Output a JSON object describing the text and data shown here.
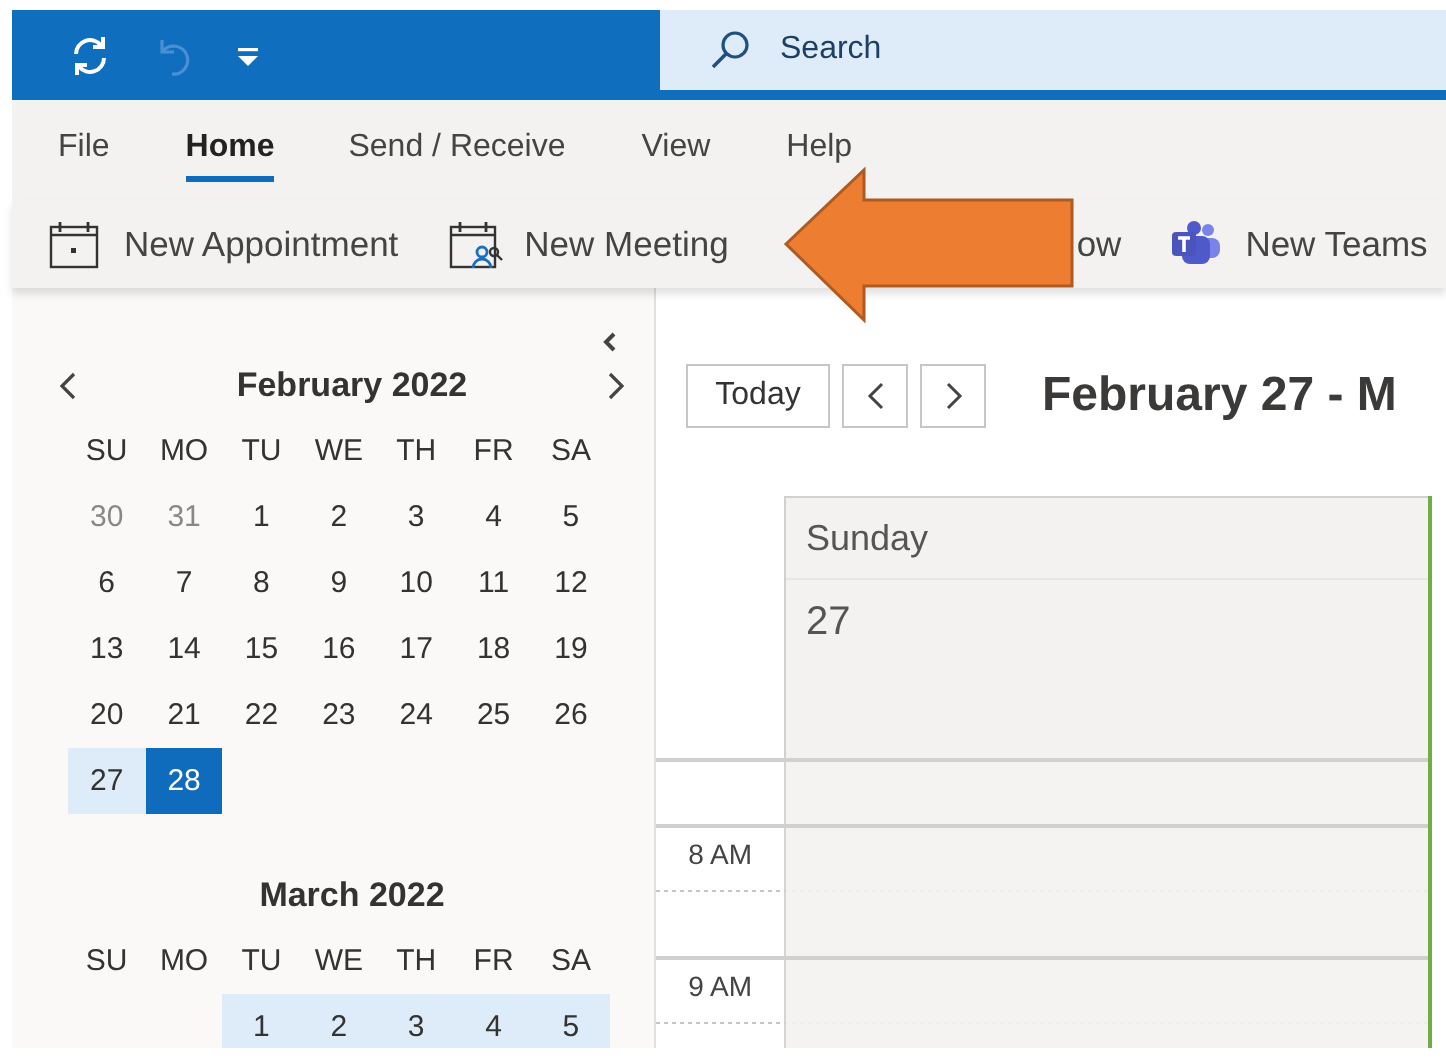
{
  "title_bar": {
    "undo": {
      "disabled": true
    },
    "search": {
      "placeholder": "Search"
    }
  },
  "menu_tabs": [
    {
      "label": "File",
      "selected": false
    },
    {
      "label": "Home",
      "selected": true
    },
    {
      "label": "Send / Receive",
      "selected": false
    },
    {
      "label": "View",
      "selected": false
    },
    {
      "label": "Help",
      "selected": false
    }
  ],
  "ribbon_buttons": [
    {
      "label": "New Appointment",
      "kind": "appointment"
    },
    {
      "label": "New Meeting",
      "kind": "meeting"
    },
    {
      "label": "ow",
      "kind": "plain"
    },
    {
      "label": "New Teams",
      "kind": "teams"
    }
  ],
  "annotation": {
    "kind": "arrow"
  },
  "sidebar": {
    "months": [
      {
        "title": "February 2022",
        "nav": true,
        "weekdays": [
          "SU",
          "MO",
          "TU",
          "WE",
          "TH",
          "FR",
          "SA"
        ],
        "weeks": [
          [
            {
              "label": "30",
              "muted": true,
              "highlighted": false,
              "selected": false
            },
            {
              "label": "31",
              "muted": true,
              "highlighted": false,
              "selected": false
            },
            {
              "label": "1",
              "muted": false,
              "highlighted": false,
              "selected": false
            },
            {
              "label": "2",
              "muted": false,
              "highlighted": false,
              "selected": false
            },
            {
              "label": "3",
              "muted": false,
              "highlighted": false,
              "selected": false
            },
            {
              "label": "4",
              "muted": false,
              "highlighted": false,
              "selected": false
            },
            {
              "label": "5",
              "muted": false,
              "highlighted": false,
              "selected": false
            }
          ],
          [
            {
              "label": "6",
              "muted": false,
              "highlighted": false,
              "selected": false
            },
            {
              "label": "7",
              "muted": false,
              "highlighted": false,
              "selected": false
            },
            {
              "label": "8",
              "muted": false,
              "highlighted": false,
              "selected": false
            },
            {
              "label": "9",
              "muted": false,
              "highlighted": false,
              "selected": false
            },
            {
              "label": "10",
              "muted": false,
              "highlighted": false,
              "selected": false
            },
            {
              "label": "11",
              "muted": false,
              "highlighted": false,
              "selected": false
            },
            {
              "label": "12",
              "muted": false,
              "highlighted": false,
              "selected": false
            }
          ],
          [
            {
              "label": "13",
              "muted": false,
              "highlighted": false,
              "selected": false
            },
            {
              "label": "14",
              "muted": false,
              "highlighted": false,
              "selected": false
            },
            {
              "label": "15",
              "muted": false,
              "highlighted": false,
              "selected": false
            },
            {
              "label": "16",
              "muted": false,
              "highlighted": false,
              "selected": false
            },
            {
              "label": "17",
              "muted": false,
              "highlighted": false,
              "selected": false
            },
            {
              "label": "18",
              "muted": false,
              "highlighted": false,
              "selected": false
            },
            {
              "label": "19",
              "muted": false,
              "highlighted": false,
              "selected": false
            }
          ],
          [
            {
              "label": "20",
              "muted": false,
              "highlighted": false,
              "selected": false
            },
            {
              "label": "21",
              "muted": false,
              "highlighted": false,
              "selected": false
            },
            {
              "label": "22",
              "muted": false,
              "highlighted": false,
              "selected": false
            },
            {
              "label": "23",
              "muted": false,
              "highlighted": false,
              "selected": false
            },
            {
              "label": "24",
              "muted": false,
              "highlighted": false,
              "selected": false
            },
            {
              "label": "25",
              "muted": false,
              "highlighted": false,
              "selected": false
            },
            {
              "label": "26",
              "muted": false,
              "highlighted": false,
              "selected": false
            }
          ],
          [
            {
              "label": "27",
              "muted": false,
              "highlighted": true,
              "selected": false
            },
            {
              "label": "28",
              "muted": false,
              "highlighted": false,
              "selected": true
            }
          ]
        ]
      },
      {
        "title": "March 2022",
        "nav": false,
        "weekdays": [
          "SU",
          "MO",
          "TU",
          "WE",
          "TH",
          "FR",
          "SA"
        ],
        "weeks": [
          [
            {
              "kind": "blank"
            },
            {
              "kind": "blank"
            },
            {
              "kind": "day",
              "label": "1",
              "muted": false,
              "highlighted": true,
              "selected": false
            },
            {
              "kind": "day",
              "label": "2",
              "muted": false,
              "highlighted": true,
              "selected": false
            },
            {
              "kind": "day",
              "label": "3",
              "muted": false,
              "highlighted": true,
              "selected": false
            },
            {
              "kind": "day",
              "label": "4",
              "muted": false,
              "highlighted": true,
              "selected": false
            },
            {
              "kind": "day",
              "label": "5",
              "muted": false,
              "highlighted": true,
              "selected": false
            }
          ]
        ]
      }
    ]
  },
  "calendar_view": {
    "today_button": "Today",
    "title": "February 27 - M",
    "days": [
      {
        "weekday": "Sunday",
        "date": "27"
      }
    ],
    "times": [
      "8 AM",
      "9 AM"
    ]
  }
}
